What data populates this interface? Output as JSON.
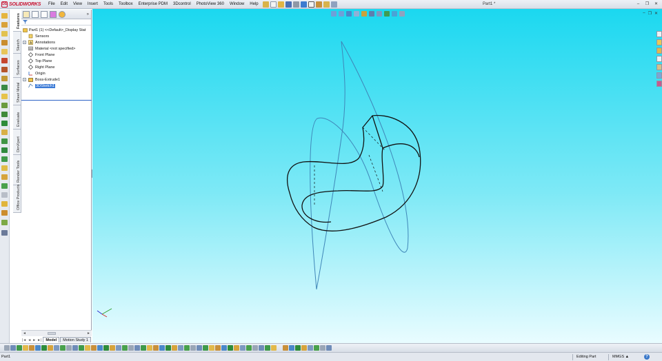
{
  "app": {
    "logo_text": "SOLIDWORKS",
    "logo_mark": "DS",
    "document_title": "Part1 *"
  },
  "menu": {
    "items": [
      "File",
      "Edit",
      "View",
      "Insert",
      "Tools",
      "Toolbox",
      "Enterprise PDM",
      "3Dcontrol",
      "PhotoView 360",
      "Window",
      "Help"
    ]
  },
  "window_controls": {
    "minimize": "–",
    "restore": "❐",
    "close": "✕"
  },
  "viewport_controls": {
    "minimize": "–",
    "restore": "❐",
    "close": "✕"
  },
  "feature_tabs": [
    "Features",
    "Sketch",
    "Surfaces",
    "Sheet Metal",
    "Evaluate",
    "DimXpert",
    "Render Tools",
    "Office Products"
  ],
  "feature_manager": {
    "collapse": "»",
    "part_title": "Part1 (1) <<Default>_Display Stat",
    "tree": [
      {
        "label": "Sensors",
        "icon": "sensor-icon",
        "expand": ""
      },
      {
        "label": "Annotations",
        "icon": "annotations-icon",
        "expand": "+"
      },
      {
        "label": "Material <not specified>",
        "icon": "material-icon",
        "expand": ""
      },
      {
        "label": "Front Plane",
        "icon": "plane-icon",
        "expand": ""
      },
      {
        "label": "Top Plane",
        "icon": "plane-icon",
        "expand": ""
      },
      {
        "label": "Right Plane",
        "icon": "plane-icon",
        "expand": ""
      },
      {
        "label": "Origin",
        "icon": "origin-icon",
        "expand": ""
      },
      {
        "label": "Boss-Extrude1",
        "icon": "extrude-icon",
        "expand": "+"
      },
      {
        "label": "3DSketch1",
        "icon": "3dsketch-icon",
        "expand": ""
      }
    ],
    "selected_index": 8
  },
  "scroll": {
    "left": "◄",
    "right": "►"
  },
  "model_tabs": {
    "nav": [
      "|◄",
      "◄",
      "►",
      "►|"
    ],
    "tabs": [
      "Model",
      "Motion Study 1"
    ],
    "active": 0
  },
  "status": {
    "left": "Part1",
    "mode": "Editing Part",
    "units": "MMGS",
    "units_arrow": "▲",
    "help": "?"
  },
  "colors": {
    "viewport_top": "#1bd8f0",
    "viewport_bottom": "#e9fcff",
    "edge": "#111111",
    "sketch": "#3f86b8",
    "selection": "#3b7ad6"
  }
}
